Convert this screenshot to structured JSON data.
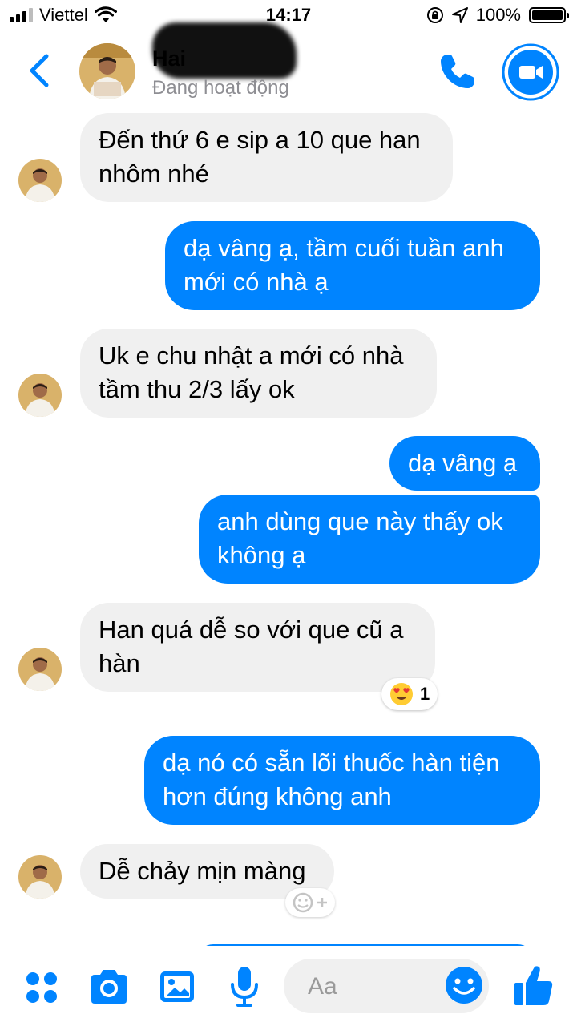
{
  "status_bar": {
    "carrier": "Viettel",
    "time": "14:17",
    "battery": "100%",
    "icons": [
      "signal-icon",
      "wifi-icon",
      "orientation-lock-icon",
      "location-icon",
      "battery-icon"
    ]
  },
  "header": {
    "name": "Hai",
    "status": "Đang hoạt động",
    "icons": [
      "back-icon",
      "phone-icon",
      "video-call-icon"
    ]
  },
  "messages": [
    {
      "direction": "incoming",
      "text": "Đến thứ 6 e sip a 10 que han\nnhôm nhé"
    },
    {
      "direction": "outgoing",
      "text": "dạ vâng ạ, tầm cuối tuần anh\nmới có nhà ạ"
    },
    {
      "direction": "incoming",
      "text": "Uk e chu nhật a mới có nhà\ntầm thu 2/3 lấy ok"
    },
    {
      "direction": "outgoing",
      "text": "dạ vâng ạ"
    },
    {
      "direction": "outgoing",
      "text": "anh dùng que này thấy ok\nkhông ạ"
    },
    {
      "direction": "incoming",
      "text": "Han quá dễ so với que cũ a\nhàn",
      "reaction": {
        "emoji": "heart-eyes",
        "count": "1"
      }
    },
    {
      "direction": "outgoing",
      "text": "dạ nó có sẵn lõi thuốc hàn tiện\nhơn đúng không anh"
    },
    {
      "direction": "incoming",
      "text": "Dễ chảy mịn màng"
    }
  ],
  "composer": {
    "placeholder": "Aa",
    "icons": [
      "apps-icon",
      "camera-icon",
      "image-icon",
      "microphone-icon",
      "emoji-icon",
      "like-icon"
    ]
  },
  "colors": {
    "accent": "#0084ff",
    "incoming_bubble": "#f0f0f0",
    "muted_text": "#8e8e93"
  }
}
